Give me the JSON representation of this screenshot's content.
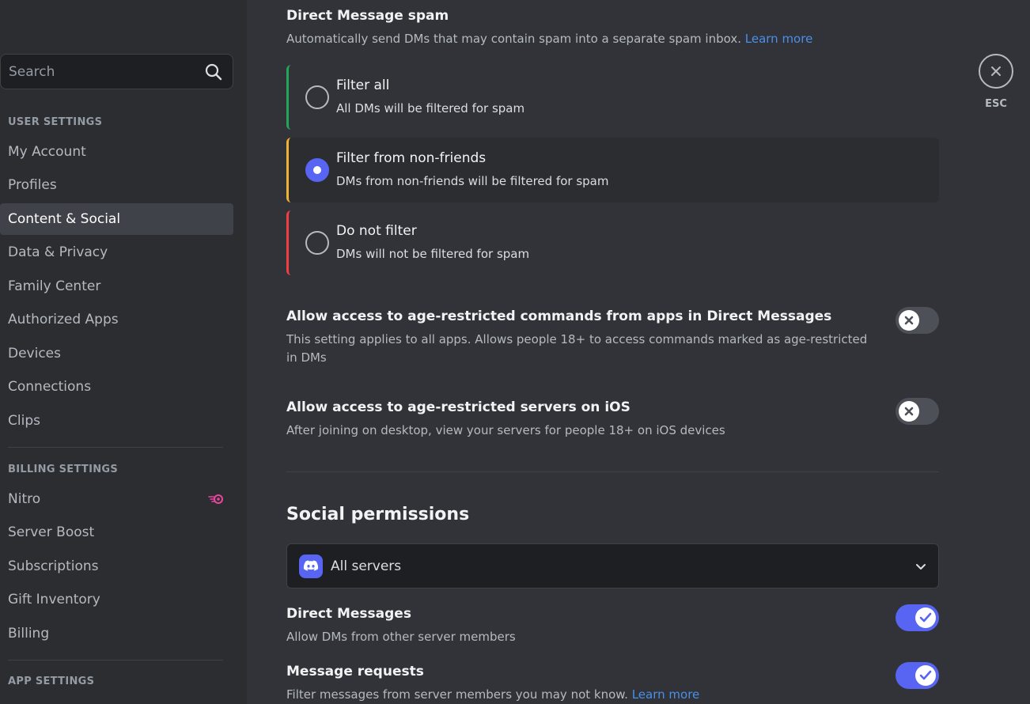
{
  "sidebar": {
    "search_placeholder": "Search",
    "user_settings_header": "USER SETTINGS",
    "user_items": [
      {
        "label": "My Account"
      },
      {
        "label": "Profiles"
      },
      {
        "label": "Content & Social"
      },
      {
        "label": "Data & Privacy"
      },
      {
        "label": "Family Center"
      },
      {
        "label": "Authorized Apps"
      },
      {
        "label": "Devices"
      },
      {
        "label": "Connections"
      },
      {
        "label": "Clips"
      }
    ],
    "billing_settings_header": "BILLING SETTINGS",
    "billing_items": [
      {
        "label": "Nitro"
      },
      {
        "label": "Server Boost"
      },
      {
        "label": "Subscriptions"
      },
      {
        "label": "Gift Inventory"
      },
      {
        "label": "Billing"
      }
    ],
    "app_settings_header": "APP SETTINGS",
    "active_item": "Content & Social"
  },
  "main": {
    "dm_spam": {
      "title": "Direct Message spam",
      "description": "Automatically send DMs that may contain spam into a separate spam inbox.",
      "learn_more": "Learn more",
      "options": [
        {
          "title": "Filter all",
          "subtitle": "All DMs will be filtered for spam",
          "selected": false
        },
        {
          "title": "Filter from non-friends",
          "subtitle": "DMs from non-friends will be filtered for spam",
          "selected": true
        },
        {
          "title": "Do not filter",
          "subtitle": "DMs will not be filtered for spam",
          "selected": false
        }
      ]
    },
    "age_commands": {
      "title": "Allow access to age-restricted commands from apps in Direct Messages",
      "description": "This setting applies to all apps. Allows people 18+ to access commands marked as age-restricted in DMs",
      "enabled": false
    },
    "age_servers_ios": {
      "title": "Allow access to age-restricted servers on iOS",
      "description": "After joining on desktop, view your servers for people 18+ on iOS devices",
      "enabled": false
    },
    "social_permissions": {
      "title": "Social permissions",
      "server_select": "All servers",
      "direct_messages": {
        "title": "Direct Messages",
        "description": "Allow DMs from other server members",
        "enabled": true
      },
      "message_requests": {
        "title": "Message requests",
        "description": "Filter messages from server members you may not know.",
        "learn_more": "Learn more",
        "enabled": true
      }
    }
  },
  "close": {
    "label": "ESC"
  },
  "colors": {
    "accent": "#5865f2",
    "filter_all_bar": "#23a55a",
    "filter_non_friends_bar": "#f0b232",
    "do_not_filter_bar": "#f23f43",
    "nitro_pink": "#eb459f"
  }
}
